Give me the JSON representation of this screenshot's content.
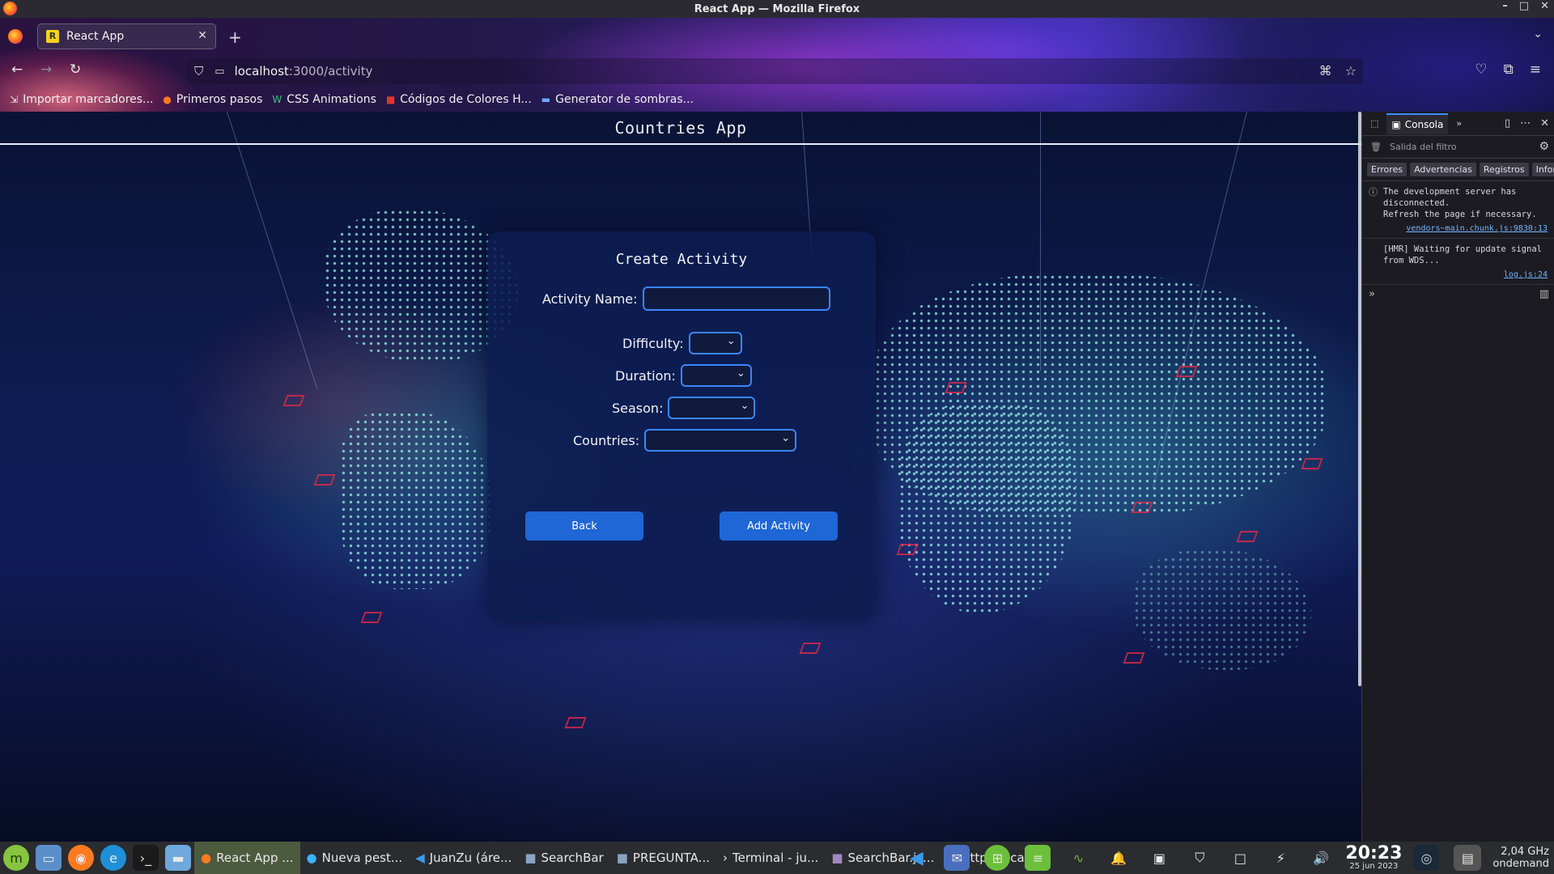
{
  "window": {
    "title": "React App — Mozilla Firefox",
    "controls": [
      "–",
      "□",
      "✕"
    ]
  },
  "browser": {
    "tab": {
      "title": "React App",
      "favicon_letter": "R"
    },
    "new_tab": "+",
    "url_host": "localhost",
    "url_path": ":3000/activity",
    "bookmarks": [
      {
        "label": "Importar marcadores...",
        "icon": "import-icon"
      },
      {
        "label": "Primeros pasos",
        "icon": "firefox-icon"
      },
      {
        "label": "CSS Animations",
        "icon": "css-icon"
      },
      {
        "label": "Códigos de Colores H...",
        "icon": "color-codes-icon"
      },
      {
        "label": "Generator de sombras...",
        "icon": "shadow-generator-icon"
      }
    ]
  },
  "app": {
    "header_title": "Countries App",
    "form": {
      "title": "Create Activity",
      "activity_name_label": "Activity Name:",
      "activity_name_value": "",
      "difficulty_label": "Difficulty:",
      "difficulty_value": "",
      "duration_label": "Duration:",
      "duration_value": "",
      "season_label": "Season:",
      "season_value": "",
      "countries_label": "Countries:",
      "countries_value": "",
      "back_label": "Back",
      "add_label": "Add Activity"
    }
  },
  "devtools": {
    "console_tab": "Consola",
    "filter_placeholder": "Salida del filtro",
    "levels": [
      "Errores",
      "Advertencias",
      "Registros",
      "Informa"
    ],
    "messages": [
      {
        "text": "The development server has disconnected.\nRefresh the page if necessary.",
        "source": "vendors~main.chunk.js:9830:13"
      },
      {
        "text": "[HMR] Waiting for update signal from WDS...",
        "source": "log.js:24"
      }
    ]
  },
  "taskbar": {
    "windows": [
      {
        "label": "React App ...",
        "active": true
      },
      {
        "label": "Nueva pest...",
        "active": false
      },
      {
        "label": "JuanZu (áre...",
        "active": false
      },
      {
        "label": "SearchBar",
        "active": false
      },
      {
        "label": "PREGUNTA...",
        "active": false
      },
      {
        "label": "Terminal - ju...",
        "active": false
      },
      {
        "label": "SearchBar.js...",
        "active": false
      },
      {
        "label": "http://local...",
        "active": false
      }
    ],
    "time": "20:23",
    "date": "25 jun 2023",
    "cpu_freq": "2,04 GHz",
    "cpu_mode": "ondemand"
  },
  "colors": {
    "accent": "#3a86ff",
    "button": "#1f66d6",
    "card": "#0c1c50"
  }
}
